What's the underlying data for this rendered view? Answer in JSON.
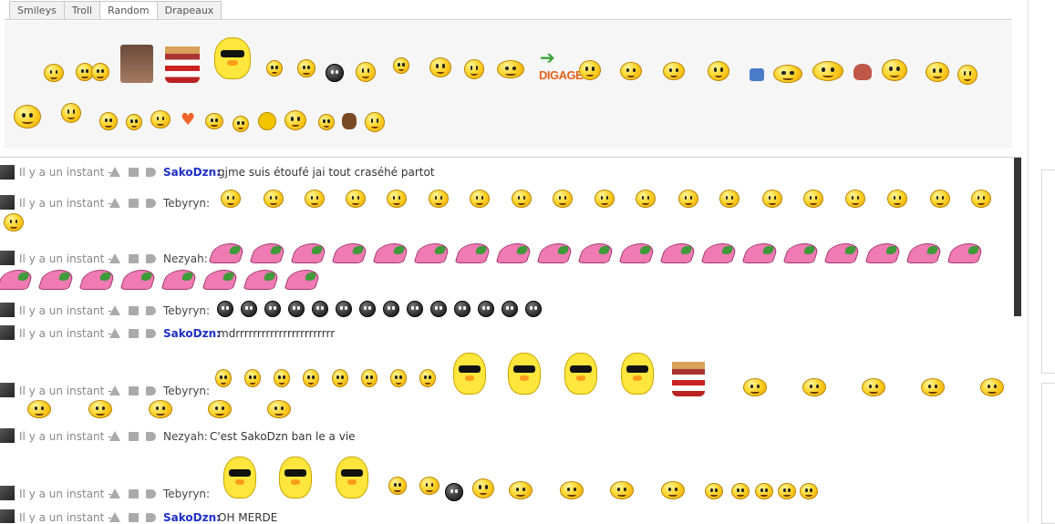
{
  "tabs": [
    {
      "label": "Smileys",
      "active": false
    },
    {
      "label": "Troll",
      "active": false
    },
    {
      "label": "Random",
      "active": true
    },
    {
      "label": "Drapeaux",
      "active": false
    }
  ],
  "picker": {
    "special_text": "DIGAGE"
  },
  "chat": {
    "messages": [
      {
        "time": "Il y a un instant -",
        "user": "SakoDzn",
        "user_style": "admin",
        "text": "gjme suis étoufé jai tout craséhé partot"
      },
      {
        "time": "Il y a un instant -",
        "user": "Tebyryn",
        "user_style": "normal",
        "text": ""
      },
      {
        "time": "Il y a un instant -",
        "user": "Nezyah",
        "user_style": "normal",
        "text": ""
      },
      {
        "time": "Il y a un instant -",
        "user": "Tebyryn",
        "user_style": "normal",
        "text": ""
      },
      {
        "time": "Il y a un instant -",
        "user": "SakoDzn",
        "user_style": "admin",
        "text": "mdrrrrrrrrrrrrrrrrrrrrrrr"
      },
      {
        "time": "Il y a un instant -",
        "user": "Tebyryn",
        "user_style": "normal",
        "text": ""
      },
      {
        "time": "Il y a un instant -",
        "user": "Nezyah",
        "user_style": "normal",
        "text": "C'est SakoDzn ban le a vie"
      },
      {
        "time": "Il y a un instant -",
        "user": "Tebyryn",
        "user_style": "normal",
        "text": ""
      },
      {
        "time": "Il y a un instant -",
        "user": "SakoDzn",
        "user_style": "admin",
        "text": "OH MERDE"
      }
    ]
  },
  "colors": {
    "accent_user": "#1f2fc8",
    "panel_bg": "#f6f6f7",
    "tab_border": "#c8c8c8"
  }
}
